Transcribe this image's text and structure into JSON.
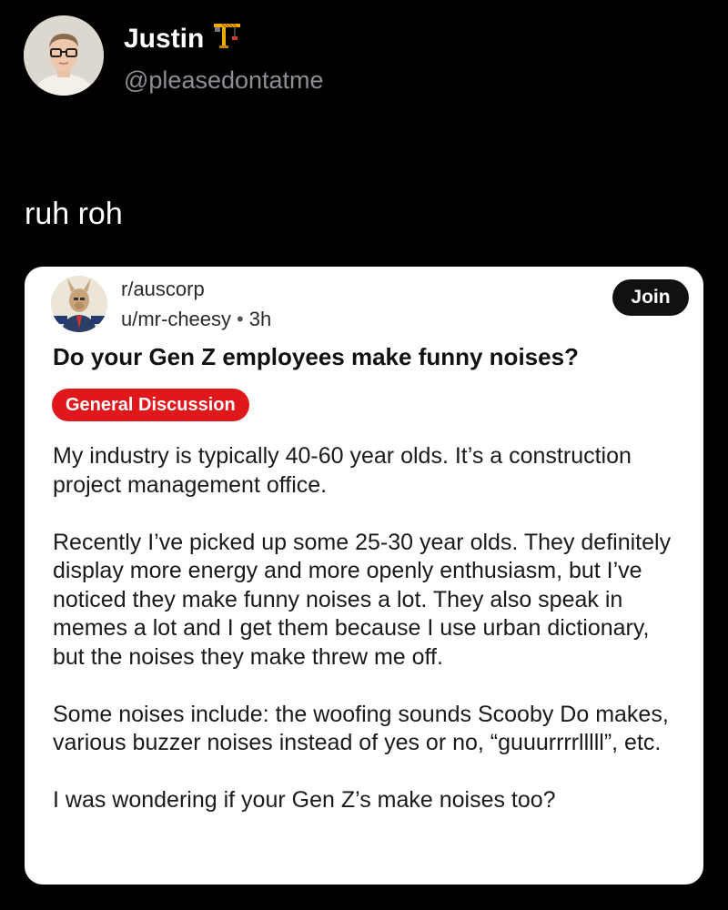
{
  "tweet": {
    "author_name": "Justin",
    "author_emoji_icon": "construction-crane-icon",
    "handle": "@pleasedontatme",
    "text": "ruh roh"
  },
  "embedded_post": {
    "subreddit": "r/auscorp",
    "username": "u/mr-cheesy",
    "separator": "•",
    "time_ago": "3h",
    "join_label": "Join",
    "title": "Do your Gen Z employees make funny noises?",
    "flair": "General Discussion",
    "flair_color": "#e0181c",
    "paragraphs": [
      "My industry is typically 40-60 year olds. It’s a construction project management office.",
      "Recently I’ve picked up some 25-30 year olds. They definitely display more energy and more openly enthusiasm, but I’ve noticed they make funny noises a lot. They also speak in memes a lot and I get them because I use urban dictionary, but the noises they make threw me off.",
      "Some noises include: the woofing sounds Scooby Do makes, various buzzer noises instead of yes or no, “guuurrrrlllll”, etc.",
      "I was wondering if your Gen Z’s make noises too?"
    ]
  }
}
